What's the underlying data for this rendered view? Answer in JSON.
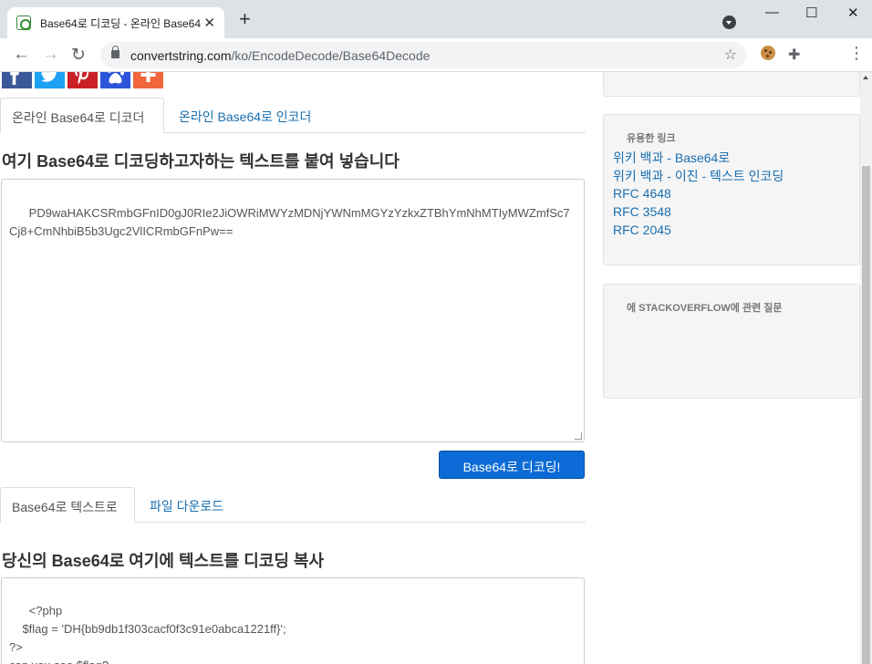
{
  "browser": {
    "tab_title": "Base64로 디코딩 - 온라인 Base64",
    "tab_close": "✕",
    "new_tab": "+",
    "url_host": "convertstring.com",
    "url_path": "/ko/EncodeDecode/Base64Decode",
    "window_controls": {
      "minimize": "—",
      "maximize": "☐",
      "close": "✕"
    }
  },
  "social_buttons": [
    {
      "name": "facebook",
      "color": "#3b5998"
    },
    {
      "name": "twitter",
      "color": "#1da1f2"
    },
    {
      "name": "pinterest",
      "color": "#cb2027"
    },
    {
      "name": "paw",
      "color": "#2c55d9"
    },
    {
      "name": "share",
      "color": "#f0673d"
    }
  ],
  "input_tabs": {
    "active": "온라인 Base64로 디코더",
    "link": "온라인 Base64로 인코더"
  },
  "input_heading": "여기 Base64로 디코딩하고자하는 텍스트를 붙여 넣습니다",
  "input_value": "PD9waHAKCSRmbGFnID0gJ0RIe2JiOWRiMWYzMDNjYWNmMGYzYzkxZTBhYmNhMTIyMWZmfSc7Cj8+CmNhbiB5b3Ugc2VlICRmbGFnPw==",
  "decode_button": "Base64로 디코딩!",
  "output_tabs": {
    "active": "Base64로 텍스트로",
    "link": "파일 다운로드"
  },
  "output_heading": "당신의 Base64로 여기에 텍스트를 디코딩 복사",
  "output_value": "<?php\n\t$flag = 'DH{bb9db1f303cacf0f3c91e0abca1221ff}';\n?>\ncan you see $flag?",
  "sidebar": {
    "useful_links_title": "유용한 링크",
    "links": [
      "위키 백과 - Base64로",
      "위키 백과 - 이진 - 텍스트 인코딩",
      "RFC 4648",
      "RFC 3548",
      "RFC 2045"
    ],
    "stackoverflow_title": "에 STACKOVERFLOW에 관련 질문"
  }
}
